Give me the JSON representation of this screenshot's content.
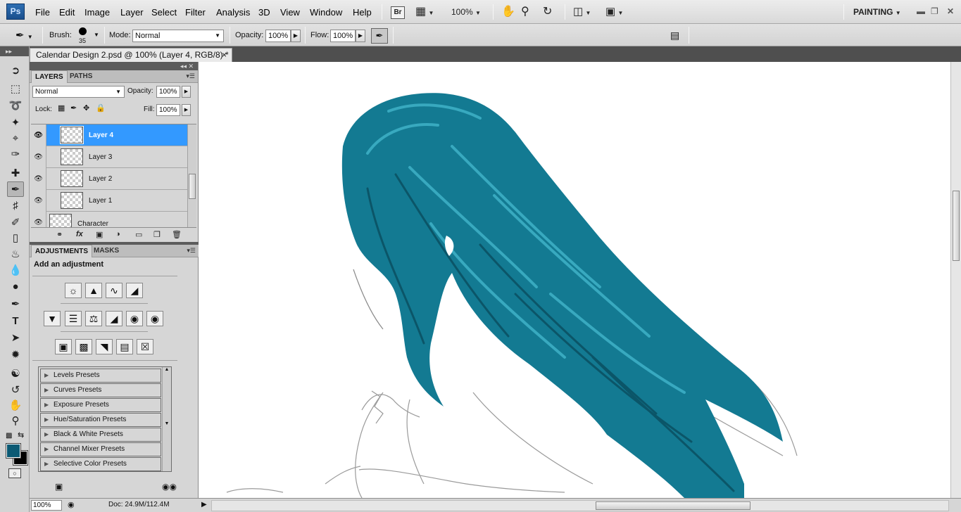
{
  "app": {
    "logo": "Ps",
    "workspace": "PAINTING",
    "zoom": "100%"
  },
  "menu": [
    "File",
    "Edit",
    "Image",
    "Layer",
    "Select",
    "Filter",
    "Analysis",
    "3D",
    "View",
    "Window",
    "Help"
  ],
  "menubar_buttons": {
    "bridge": "Br",
    "zoom": "100%"
  },
  "options": {
    "brush_label": "Brush:",
    "brush_size": "35",
    "mode_label": "Mode:",
    "mode_value": "Normal",
    "opacity_label": "Opacity:",
    "opacity_value": "100%",
    "flow_label": "Flow:",
    "flow_value": "100%"
  },
  "document": {
    "tab_title": "Calendar Design 2.psd @ 100% (Layer 4, RGB/8) *",
    "close": "×"
  },
  "layers_panel": {
    "tabs": [
      "LAYERS",
      "PATHS"
    ],
    "blend_mode": "Normal",
    "opacity_label": "Opacity:",
    "opacity_value": "100%",
    "lock_label": "Lock:",
    "fill_label": "Fill:",
    "fill_value": "100%",
    "layers": [
      {
        "name": "Layer 4",
        "selected": true
      },
      {
        "name": "Layer 3",
        "selected": false
      },
      {
        "name": "Layer 2",
        "selected": false
      },
      {
        "name": "Layer 1",
        "selected": false
      },
      {
        "name": "Character",
        "selected": false
      }
    ]
  },
  "adjustments_panel": {
    "tabs": [
      "ADJUSTMENTS",
      "MASKS"
    ],
    "title": "Add an adjustment",
    "presets": [
      "Levels Presets",
      "Curves Presets",
      "Exposure Presets",
      "Hue/Saturation Presets",
      "Black & White Presets",
      "Channel Mixer Presets",
      "Selective Color Presets"
    ]
  },
  "status": {
    "zoom": "100%",
    "doc_info": "Doc: 24.9M/112.4M"
  },
  "colors": {
    "foreground": "#0b5a74",
    "background": "#000000",
    "hair": "#137a92",
    "selection": "#3399ff"
  }
}
